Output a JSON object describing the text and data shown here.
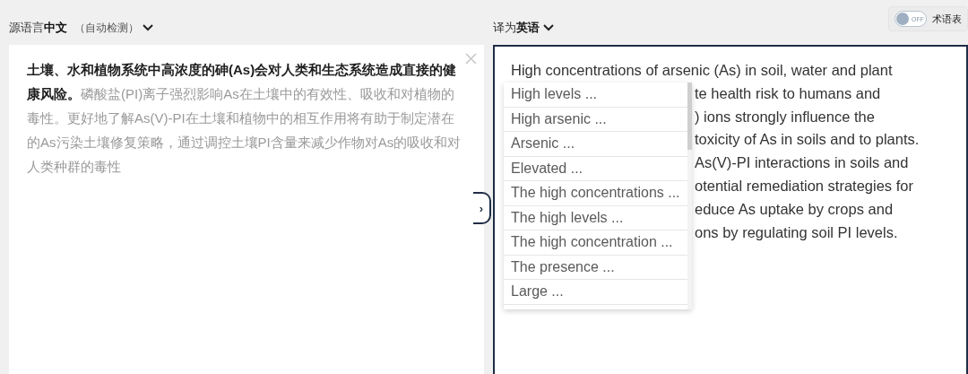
{
  "source": {
    "prefix": "源语言",
    "language": "中文",
    "detect": "（自动检测）",
    "text": "**土壤、水和植物系统中高浓度的砷(As)会对人类和生态系统造成直接的健康风险。**磷酸盐(PI)离子强烈影响As在土壤中的有效性、吸收和对植物的毒性。更好地了解As(V)-PI在土壤和植物中的相互作用将有助于制定潜在的As污染土壤修复策略，通过调控土壤PI含量来减少作物对As的吸收和对人类种群的毒性"
  },
  "target": {
    "prefix": "译为",
    "language": "英语",
    "lines": [
      {
        "text": "High concentrations of arsenic (As) in soil, water and plant",
        "covered": false
      },
      {
        "text": "te health risk to humans and",
        "covered": true
      },
      {
        "text": ") ions strongly influence the",
        "covered": true
      },
      {
        "text": "toxicity of As in soils and to plants.",
        "covered": true
      },
      {
        "text": "As(V)-PI interactions in soils and",
        "covered": true
      },
      {
        "text": "otential remediation strategies for",
        "covered": true
      },
      {
        "text": "educe As uptake by crops and",
        "covered": true
      },
      {
        "text": "ons by regulating soil PI levels.",
        "covered": true
      }
    ]
  },
  "glossary": {
    "label": "术语表",
    "switch_text": "OFF",
    "on": false
  },
  "collapse_button": {
    "symbol": "›"
  },
  "suggestions": [
    {
      "text": "High levels ..."
    },
    {
      "text": "High arsenic ..."
    },
    {
      "text": "Arsenic ..."
    },
    {
      "text": "Elevated ..."
    },
    {
      "text": "The high concentrations ..."
    },
    {
      "text": "The high levels ..."
    },
    {
      "text": "The high concentration ..."
    },
    {
      "text": "The presence ..."
    },
    {
      "text": "Large ..."
    }
  ]
}
